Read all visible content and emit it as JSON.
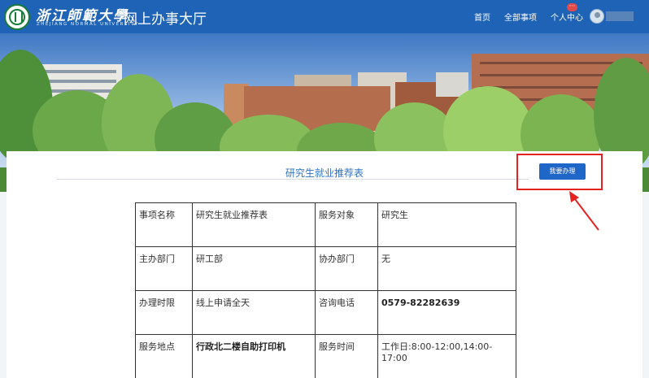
{
  "header": {
    "school_name": "浙江師範大學",
    "school_name_en": "ZHEJIANG NORMAL UNIVERSITY",
    "portal_title": "网上办事大厅",
    "nav": {
      "home": "首页",
      "all_items": "全部事项",
      "user_center": "个人中心"
    },
    "badge": "···"
  },
  "item": {
    "title": "研究生就业推荐表",
    "apply_label": "我要办理"
  },
  "table": {
    "rows": [
      [
        "事项名称",
        "研究生就业推荐表",
        "服务对象",
        "研究生"
      ],
      [
        "主办部门",
        "研工部",
        "协办部门",
        "无"
      ],
      [
        "办理时限",
        "线上申请全天",
        "咨询电话",
        "0579-82282639"
      ],
      [
        "服务地点",
        "行政北二楼自助打印机",
        "服务时间",
        "工作日:8:00-12:00,14:00-17:00"
      ]
    ]
  },
  "colors": {
    "header_blue": "#1f63b6",
    "button_blue": "#1e66c8",
    "highlight_red": "#e42222"
  }
}
